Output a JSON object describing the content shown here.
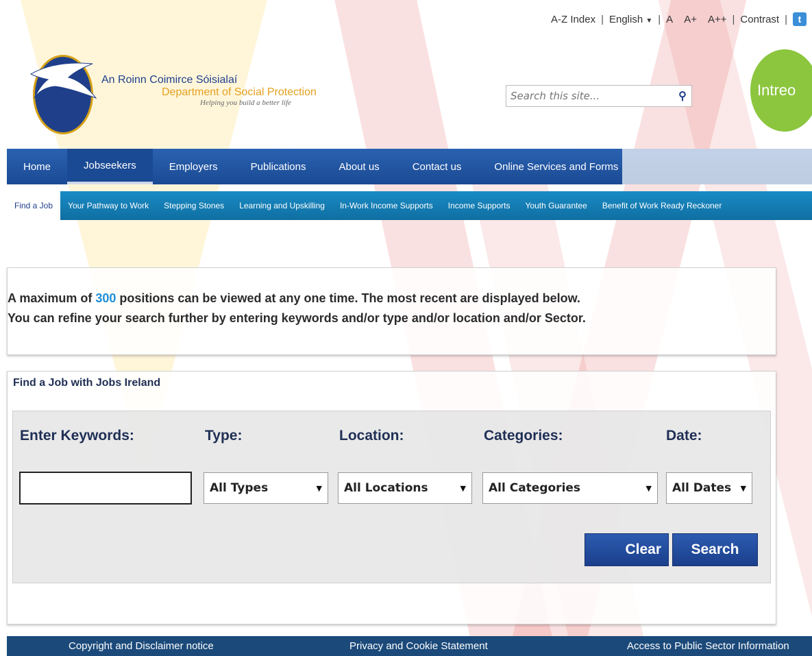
{
  "utility": {
    "az_index": "A-Z Index",
    "language": "English",
    "font_a": "A",
    "font_a_plus": "A+",
    "font_a_plus_plus": "A++",
    "contrast": "Contrast",
    "social_icon": "twitter-icon"
  },
  "header": {
    "dept_irish": "An Roinn Coimirce Sóisialaí",
    "dept_english": "Department of Social Protection",
    "tagline": "Helping you build a better life",
    "intreo_logo_text": "Intreo"
  },
  "search": {
    "placeholder": "Search this site...",
    "icon": "search-icon"
  },
  "main_nav": [
    {
      "label": "Home"
    },
    {
      "label": "Jobseekers",
      "active": true
    },
    {
      "label": "Employers"
    },
    {
      "label": "Publications"
    },
    {
      "label": "About us"
    },
    {
      "label": "Contact us"
    },
    {
      "label": "Online Services and Forms"
    }
  ],
  "sub_nav": [
    {
      "label": "Find a Job",
      "active": true
    },
    {
      "label": "Your Pathway to Work"
    },
    {
      "label": "Stepping Stones"
    },
    {
      "label": "Learning and Upskilling"
    },
    {
      "label": "In-Work Income Supports"
    },
    {
      "label": "Income Supports"
    },
    {
      "label": "Youth Guarantee"
    },
    {
      "label": "Benefit of Work Ready Reckoner"
    }
  ],
  "info": {
    "line1_prefix": "A maximum of ",
    "line1_number": "300",
    "line1_suffix": " positions can be viewed at any one time. The most recent are displayed below.",
    "line2": "You can refine your search further by entering keywords and/or type and/or location and/or Sector."
  },
  "find_job": {
    "title": "Find a Job with Jobs Ireland",
    "keywords_label": "Enter Keywords:",
    "keywords_value": "",
    "type_label": "Type:",
    "type_selected": "All Types",
    "location_label": "Location:",
    "location_selected": "All Locations",
    "categories_label": "Categories:",
    "categories_selected": "All Categories",
    "date_label": "Date:",
    "date_selected": "All Dates",
    "clear_label": "Clear",
    "search_label": "Search"
  },
  "footer": {
    "copyright": "Copyright and Disclaimer notice",
    "privacy": "Privacy and Cookie Statement",
    "access": "Access to Public Sector Information"
  },
  "colors": {
    "main_nav": "#1b4a94",
    "sub_nav": "#0f6fa2",
    "button": "#1b3f8c",
    "highlight": "#1d8ed8",
    "footer": "#1b4a7a"
  }
}
